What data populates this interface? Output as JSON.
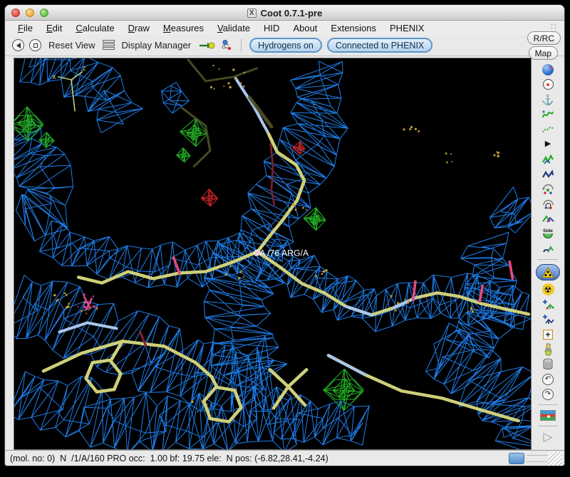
{
  "window": {
    "title": "Coot 0.7.1-pre",
    "icon_letter": "X"
  },
  "menubar": {
    "items": [
      "File",
      "Edit",
      "Calculate",
      "Draw",
      "Measures",
      "Validate",
      "HID",
      "About",
      "Extensions",
      "PHENIX"
    ]
  },
  "toolbar": {
    "reset_view_label": "Reset View",
    "display_manager_label": "Display Manager",
    "hydrogens_button": "Hydrogens on",
    "phenix_button": "Connected to PHENIX"
  },
  "map_controls": {
    "rrc_button": "R/RC",
    "map_button": "Map"
  },
  "right_toolbar": {
    "side_chain_label": "Side"
  },
  "canvas": {
    "pick_label": "CA /76 ARG/A",
    "axis_labels": {
      "x": "x",
      "z": "z"
    },
    "colors": {
      "background": "#000000",
      "density_2fofc": "#1e7de8",
      "density_pos": "#22a822",
      "density_neg": "#c32525",
      "model_carbon": "#cfcf7a",
      "model_nitrogen": "#a9c6ee",
      "model_pink": "#e8487e",
      "model_dark": "#55552a",
      "model_darkred": "#801f30",
      "waters_dots": "#c0992c",
      "magenta_dots": "#cc44aa",
      "axes": "#c7d48a",
      "label_text": "#ffffff",
      "pick_atom": "#eec6d2"
    }
  },
  "statusbar": {
    "text": "(mol. no: 0)  N  /1/A/160 PRO occ:  1.00 bf: 19.75 ele:  N pos: (-6.82,28.41,-4.24)"
  }
}
